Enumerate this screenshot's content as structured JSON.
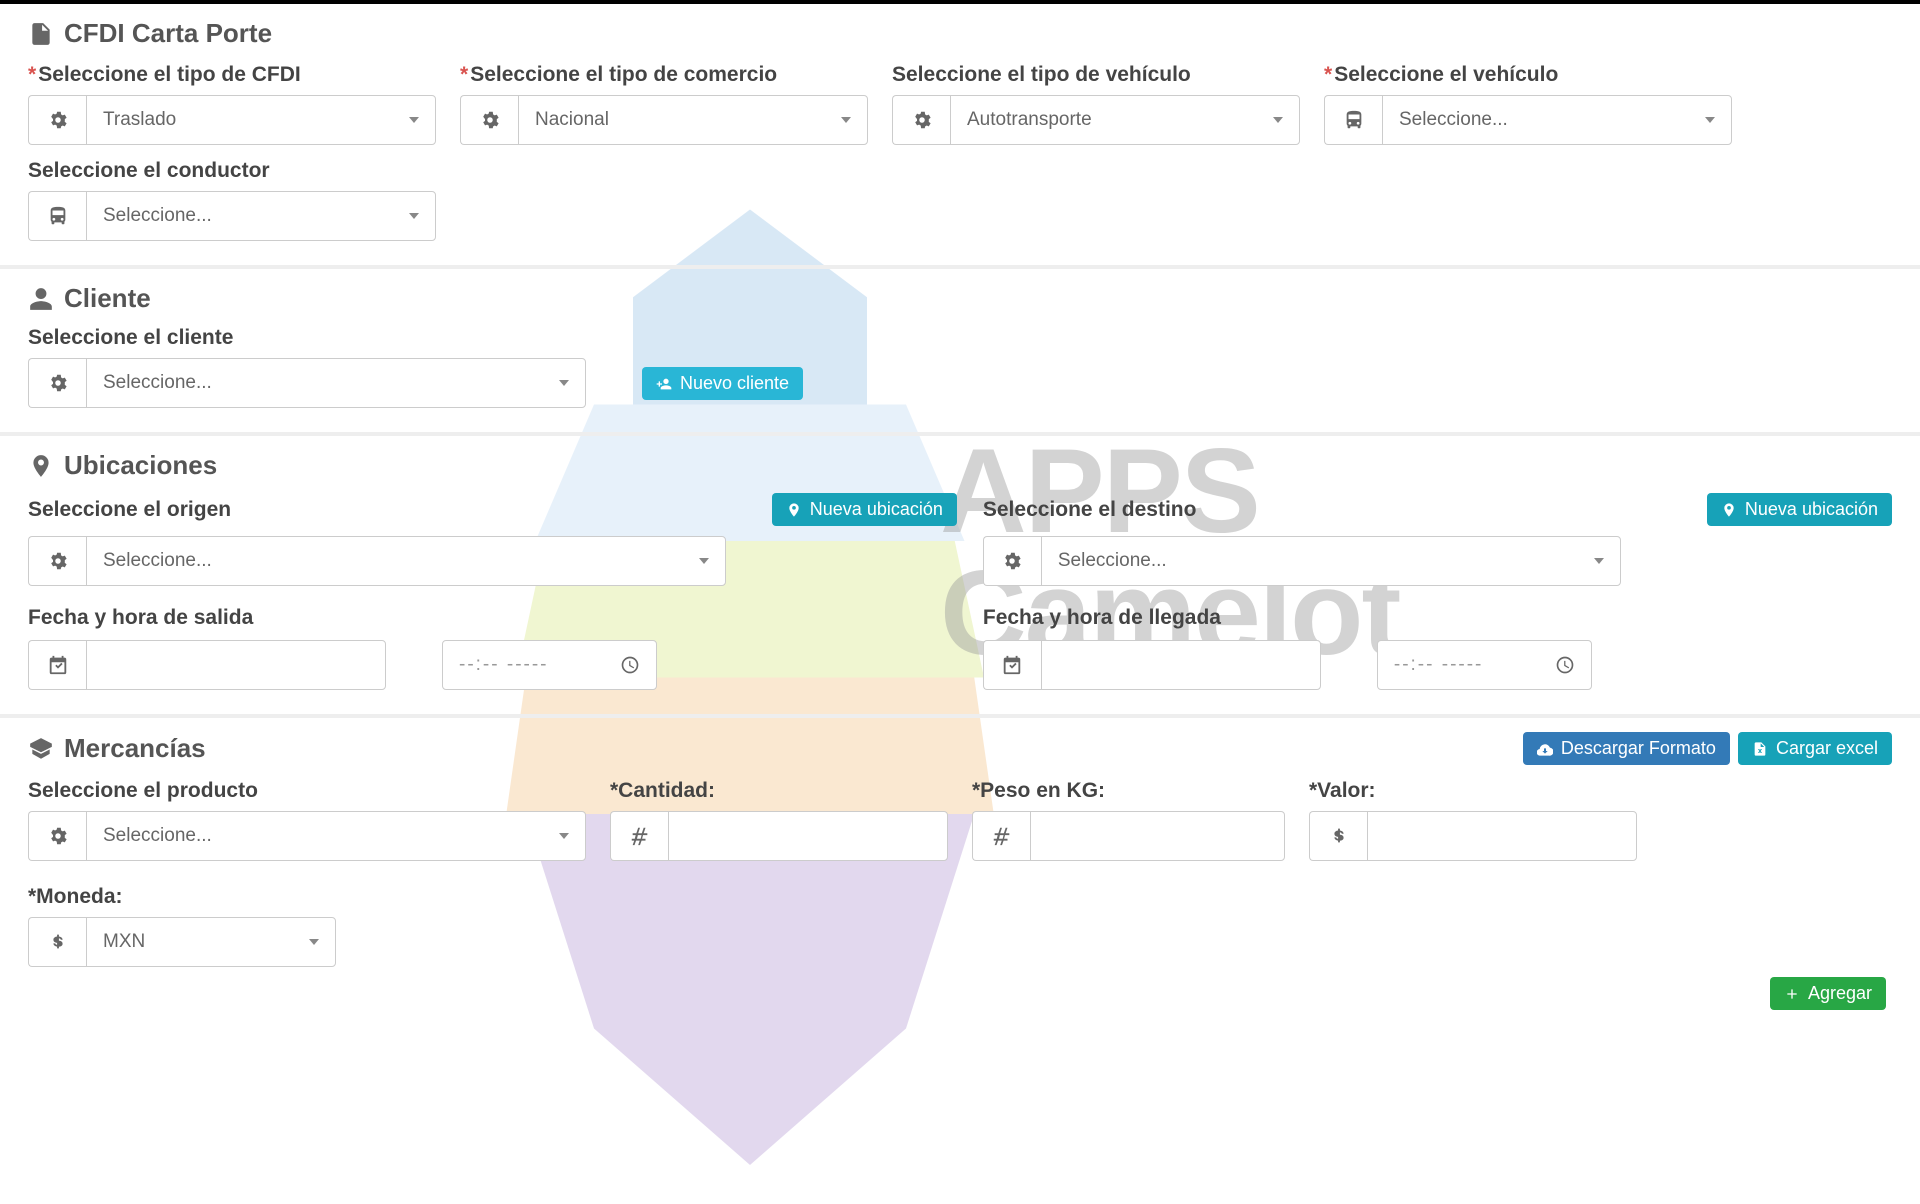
{
  "page": {
    "title": "CFDI Carta Porte"
  },
  "cfdi": {
    "tipo_cfdi": {
      "label": "Seleccione el tipo de CFDI",
      "value": "Traslado",
      "required": true
    },
    "tipo_comercio": {
      "label": "Seleccione el tipo de comercio",
      "value": "Nacional",
      "required": true
    },
    "tipo_vehiculo": {
      "label": "Seleccione el tipo de vehículo",
      "value": "Autotransporte",
      "required": false
    },
    "vehiculo": {
      "label": "Seleccione el vehículo",
      "value": "Seleccione...",
      "required": true
    },
    "conductor": {
      "label": "Seleccione el conductor",
      "value": "Seleccione..."
    }
  },
  "cliente": {
    "section": "Cliente",
    "sel": {
      "label": "Seleccione el cliente",
      "value": "Seleccione..."
    },
    "nuevo": "Nuevo cliente"
  },
  "ubicaciones": {
    "section": "Ubicaciones",
    "origen": {
      "label": "Seleccione el origen",
      "value": "Seleccione...",
      "datetime_label": "Fecha y hora de salida",
      "time_placeholder": "--:-- -----"
    },
    "destino": {
      "label": "Seleccione el destino",
      "value": "Seleccione...",
      "datetime_label": "Fecha y hora de llegada",
      "time_placeholder": "--:-- -----"
    },
    "nueva": "Nueva ubicación"
  },
  "mercancias": {
    "section": "Mercancías",
    "descargar": "Descargar Formato",
    "cargar": "Cargar excel",
    "producto": {
      "label": "Seleccione el producto",
      "value": "Seleccione..."
    },
    "cantidad": {
      "label": "*Cantidad:"
    },
    "peso": {
      "label": "*Peso en KG:"
    },
    "valor": {
      "label": "*Valor:"
    },
    "moneda": {
      "label": "*Moneda:",
      "value": "MXN"
    },
    "agregar": "Agregar"
  },
  "watermark": {
    "line1": "APPS",
    "line2": "Camelot"
  }
}
